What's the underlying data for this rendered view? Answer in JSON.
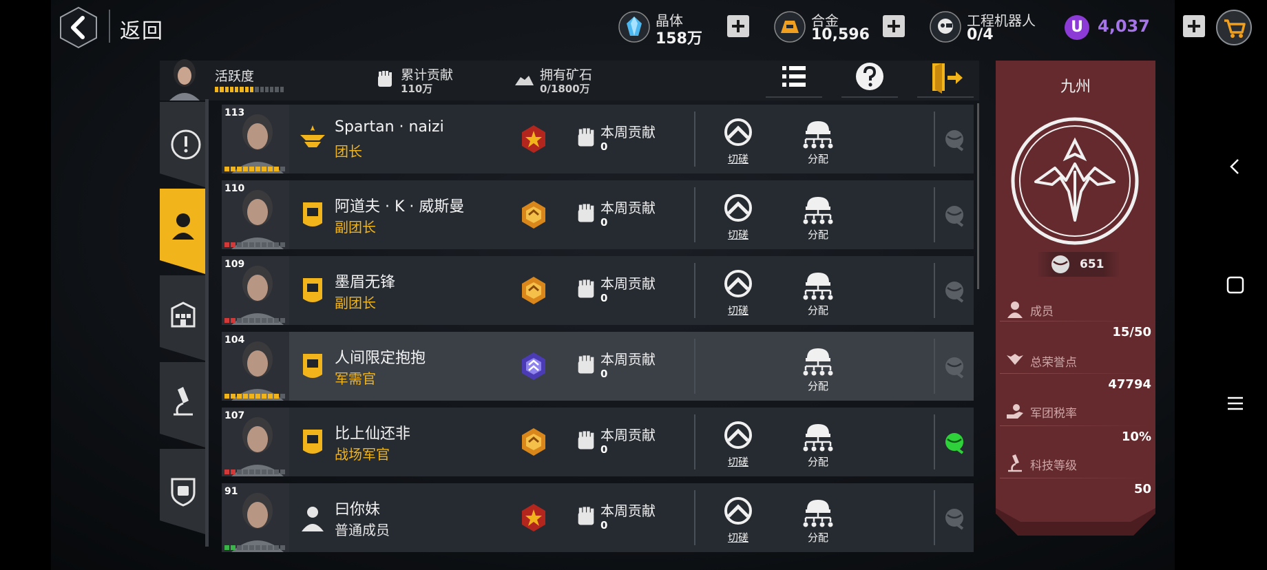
{
  "nav": {
    "back_label": "返回"
  },
  "resources": [
    {
      "label": "晶体",
      "value": "158万",
      "icon": "crystal-icon"
    },
    {
      "label": "合金",
      "value": "10,596",
      "icon": "alloy-icon"
    },
    {
      "label": "工程机器人",
      "value": "0/4",
      "icon": "robot-icon"
    }
  ],
  "credits": {
    "symbol": "U",
    "value": "4,037"
  },
  "summary": {
    "activity_label": "活跃度",
    "activity_level": 0.6,
    "contribution_label": "累计贡献",
    "contribution_value": "110万",
    "ore_label": "拥有矿石",
    "ore_value": "0/1800万"
  },
  "members": [
    {
      "level": "113",
      "name": "Spartan · naizi",
      "title": "团长",
      "weekly_label": "本周贡献",
      "weekly_value": "0",
      "duel_label": "切磋",
      "assign_label": "分配",
      "medal": "red-star-medal",
      "pip_color": "#f2b41b",
      "highlight": false,
      "duel": true,
      "ore_active": false
    },
    {
      "level": "110",
      "name": "阿道夫 · K · 威斯曼",
      "title": "副团长",
      "weekly_label": "本周贡献",
      "weekly_value": "0",
      "duel_label": "切磋",
      "assign_label": "分配",
      "medal": "gold-medal",
      "pip_color": "#d23a3a",
      "highlight": false,
      "duel": true,
      "ore_active": false
    },
    {
      "level": "109",
      "name": "墨眉无锋",
      "title": "副团长",
      "weekly_label": "本周贡献",
      "weekly_value": "0",
      "duel_label": "切磋",
      "assign_label": "分配",
      "medal": "gold-medal",
      "pip_color": "#d23a3a",
      "highlight": false,
      "duel": true,
      "ore_active": false
    },
    {
      "level": "104",
      "name": "人间限定抱抱",
      "title": "军需官",
      "weekly_label": "本周贡献",
      "weekly_value": "0",
      "duel_label": "",
      "assign_label": "分配",
      "medal": "purple-medal",
      "pip_color": "#f2b41b",
      "highlight": true,
      "duel": false,
      "ore_active": false
    },
    {
      "level": "107",
      "name": "比上仙还非",
      "title": "战场军官",
      "weekly_label": "本周贡献",
      "weekly_value": "0",
      "duel_label": "切磋",
      "assign_label": "分配",
      "medal": "gold-medal",
      "pip_color": "#d23a3a",
      "highlight": false,
      "duel": true,
      "ore_active": true
    },
    {
      "level": "91",
      "name": "曰你妹",
      "title": "普通成员",
      "weekly_label": "本周贡献",
      "weekly_value": "0",
      "duel_label": "切磋",
      "assign_label": "分配",
      "medal": "red-star-medal",
      "pip_color": "#3bb54a",
      "highlight": false,
      "duel": true,
      "ore_active": false
    }
  ],
  "guild": {
    "name": "九州",
    "score": "651",
    "stats": [
      {
        "label": "成员",
        "value": "15/50",
        "icon": "member-icon"
      },
      {
        "label": "总荣誉点",
        "value": "47794",
        "icon": "wings-icon"
      },
      {
        "label": "军团税率",
        "value": "10%",
        "icon": "tax-hand-icon"
      },
      {
        "label": "科技等级",
        "value": "50",
        "icon": "microscope-icon"
      }
    ]
  },
  "colors": {
    "accent": "#f2b41b",
    "panel": "#5e2529",
    "credit": "#a574e8",
    "active_ore": "#2fd13a"
  }
}
